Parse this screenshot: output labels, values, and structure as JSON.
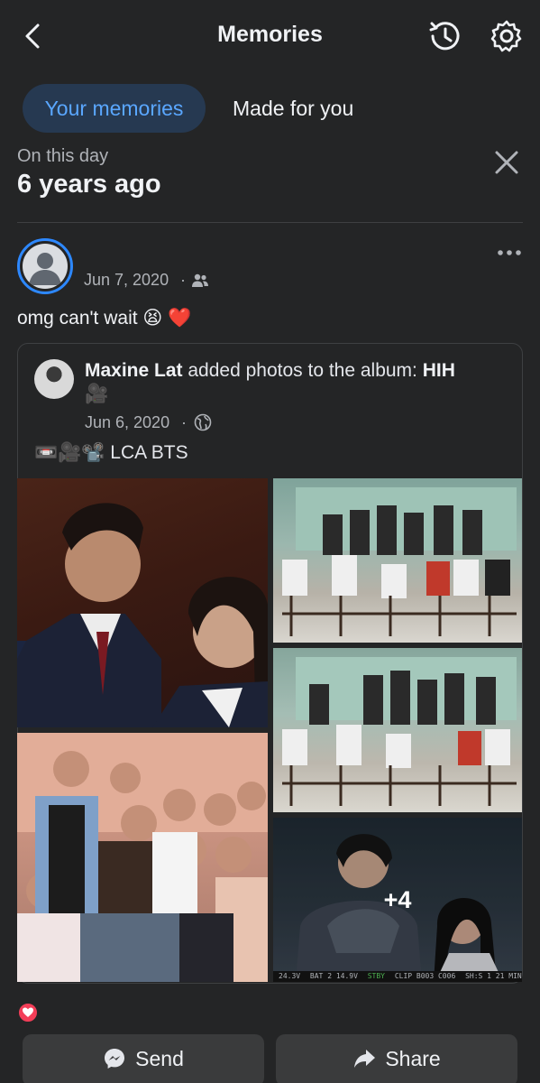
{
  "header": {
    "title": "Memories"
  },
  "tabs": [
    {
      "label": "Your memories",
      "active": true
    },
    {
      "label": "Made for you",
      "active": false
    }
  ],
  "on_this_day": {
    "label": "On this day",
    "years_ago": "6 years ago"
  },
  "post": {
    "date": "Jun 7, 2020",
    "separator": "·",
    "audience_icon": "friends-icon",
    "text": "omg can't wait 😫 ❤️",
    "shared": {
      "author": "Maxine Lat",
      "action": " added photos to the album: ",
      "album": "HIH",
      "album_emoji": "🎥",
      "date": "Jun 6, 2020",
      "separator": "·",
      "audience_icon": "globe-icon",
      "caption": "📼🎥📽️ LCA BTS",
      "more_photos": "+4",
      "camera_overlay": [
        "24.3V",
        "BAT 2 14.9V",
        "STBY",
        "CLIP B003 C006",
        "SH:S 1 21 MIN"
      ]
    },
    "reaction_icon": "heart-icon"
  },
  "actions": {
    "send_label": "Send",
    "share_label": "Share"
  },
  "colors": {
    "background": "#242526",
    "accent": "#5aa7ff",
    "tab_active_bg": "#263951",
    "reaction_red": "#f33e58"
  }
}
